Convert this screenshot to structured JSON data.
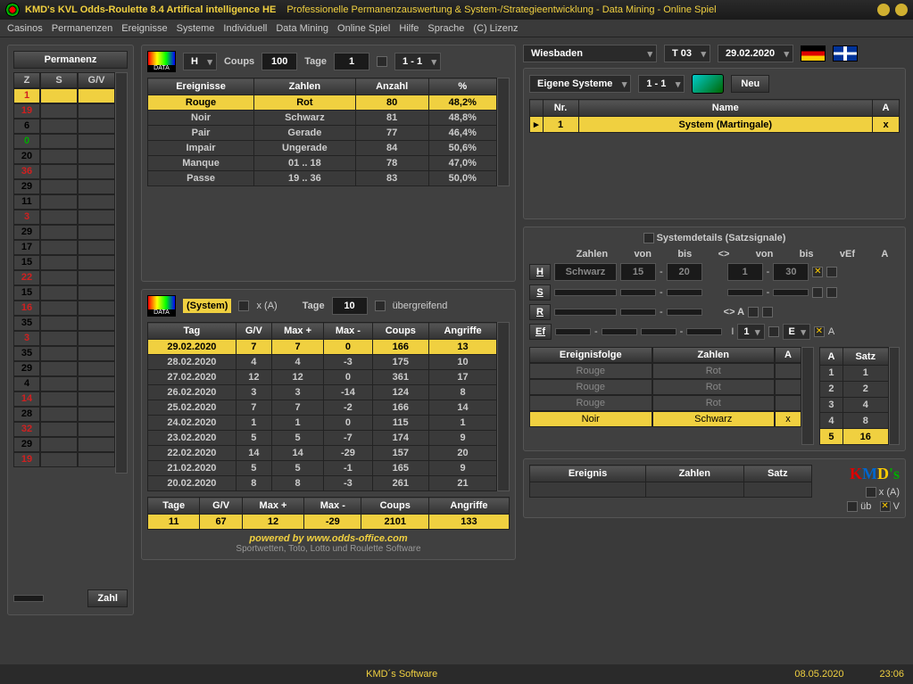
{
  "title1": "KMD's KVL Odds-Roulette 8.4 Artifical intelligence HE",
  "title2": "Professionelle Permanenzauswertung & System-/Strategieentwicklung - Data Mining - Online Spiel",
  "menu": [
    "Casinos",
    "Permanenzen",
    "Ereignisse",
    "Systeme",
    "Individuell",
    "Data Mining",
    "Online Spiel",
    "Hilfe",
    "Sprache",
    "(C) Lizenz"
  ],
  "permanenz": {
    "title": "Permanenz",
    "headers": [
      "Z",
      "S",
      "G/V"
    ],
    "rows": [
      {
        "z": "1",
        "c": "red",
        "hl": true
      },
      {
        "z": "19",
        "c": "red"
      },
      {
        "z": "6",
        "c": "black"
      },
      {
        "z": "0",
        "c": "green"
      },
      {
        "z": "20",
        "c": "black"
      },
      {
        "z": "36",
        "c": "red"
      },
      {
        "z": "29",
        "c": "black"
      },
      {
        "z": "11",
        "c": "black"
      },
      {
        "z": "3",
        "c": "red"
      },
      {
        "z": "29",
        "c": "black"
      },
      {
        "z": "17",
        "c": "black"
      },
      {
        "z": "15",
        "c": "black"
      },
      {
        "z": "22",
        "c": "red"
      },
      {
        "z": "15",
        "c": "black"
      },
      {
        "z": "16",
        "c": "red"
      },
      {
        "z": "35",
        "c": "black"
      },
      {
        "z": "3",
        "c": "red"
      },
      {
        "z": "35",
        "c": "black"
      },
      {
        "z": "29",
        "c": "black"
      },
      {
        "z": "4",
        "c": "black"
      },
      {
        "z": "14",
        "c": "red"
      },
      {
        "z": "28",
        "c": "black"
      },
      {
        "z": "32",
        "c": "red"
      },
      {
        "z": "29",
        "c": "black"
      },
      {
        "z": "19",
        "c": "red"
      }
    ],
    "zahl_btn": "Zahl"
  },
  "top2": {
    "h": "H",
    "coups_lbl": "Coups",
    "coups": "100",
    "tage_lbl": "Tage",
    "tage": "1",
    "range": "1 - 1"
  },
  "ereignisse": {
    "headers": [
      "Ereignisse",
      "Zahlen",
      "Anzahl",
      "%"
    ],
    "rows": [
      {
        "e": "Rouge",
        "z": "Rot",
        "a": "80",
        "p": "48,2%",
        "hl": true
      },
      {
        "e": "Noir",
        "z": "Schwarz",
        "a": "81",
        "p": "48,8%"
      },
      {
        "e": "Pair",
        "z": "Gerade",
        "a": "77",
        "p": "46,4%"
      },
      {
        "e": "Impair",
        "z": "Ungerade",
        "a": "84",
        "p": "50,6%"
      },
      {
        "e": "Manque",
        "z": "01 .. 18",
        "a": "78",
        "p": "47,0%"
      },
      {
        "e": "Passe",
        "z": "19 .. 36",
        "a": "83",
        "p": "50,0%"
      }
    ]
  },
  "system_panel": {
    "label": "(System)",
    "xa": "x (A)",
    "tage_lbl": "Tage",
    "tage": "10",
    "uber": "übergreifend",
    "headers": [
      "Tag",
      "G/V",
      "Max +",
      "Max -",
      "Coups",
      "Angriffe"
    ],
    "rows": [
      {
        "d": "29.02.2020",
        "gv": "7",
        "mp": "7",
        "mm": "0",
        "c": "166",
        "a": "13",
        "hl": true
      },
      {
        "d": "28.02.2020",
        "gv": "4",
        "mp": "4",
        "mm": "-3",
        "c": "175",
        "a": "10"
      },
      {
        "d": "27.02.2020",
        "gv": "12",
        "mp": "12",
        "mm": "0",
        "c": "361",
        "a": "17"
      },
      {
        "d": "26.02.2020",
        "gv": "3",
        "mp": "3",
        "mm": "-14",
        "c": "124",
        "a": "8"
      },
      {
        "d": "25.02.2020",
        "gv": "7",
        "mp": "7",
        "mm": "-2",
        "c": "166",
        "a": "14"
      },
      {
        "d": "24.02.2020",
        "gv": "1",
        "mp": "1",
        "mm": "0",
        "c": "115",
        "a": "1"
      },
      {
        "d": "23.02.2020",
        "gv": "5",
        "mp": "5",
        "mm": "-7",
        "c": "174",
        "a": "9"
      },
      {
        "d": "22.02.2020",
        "gv": "14",
        "mp": "14",
        "mm": "-29",
        "c": "157",
        "a": "20"
      },
      {
        "d": "21.02.2020",
        "gv": "5",
        "mp": "5",
        "mm": "-1",
        "c": "165",
        "a": "9"
      },
      {
        "d": "20.02.2020",
        "gv": "8",
        "mp": "8",
        "mm": "-3",
        "c": "261",
        "a": "21"
      }
    ],
    "sum_headers": [
      "Tage",
      "G/V",
      "Max +",
      "Max -",
      "Coups",
      "Angriffe"
    ],
    "sum": {
      "d": "11",
      "gv": "67",
      "mp": "12",
      "mm": "-29",
      "c": "2101",
      "a": "133"
    }
  },
  "footer1": "powered by www.odds-office.com",
  "footer2": "Sportwetten, Toto, Lotto und Roulette Software",
  "top3": {
    "casino": "Wiesbaden",
    "table": "T 03",
    "date": "29.02.2020"
  },
  "syslist": {
    "sel": "Eigene Systeme",
    "range": "1 - 1",
    "neu": "Neu",
    "headers": [
      "Nr.",
      "Name",
      "A"
    ],
    "rows": [
      {
        "nr": "1",
        "name": "System (Martingale)",
        "a": "x",
        "hl": true
      }
    ]
  },
  "details": {
    "title": "Systemdetails   (Satzsignale)",
    "cols": [
      "Zahlen",
      "von",
      "bis",
      "<>",
      "von",
      "bis",
      "vEf",
      "A"
    ],
    "btns": [
      "H",
      "S",
      "R",
      "Ef"
    ],
    "row1_z": "Schwarz",
    "row1_v1": "15",
    "row1_b1": "20",
    "row1_v2": "1",
    "row1_b2": "30",
    "arrow_lbl": "<> A",
    "one": "1",
    "e": "E",
    "a": "A"
  },
  "folge": {
    "headers": [
      "Ereignisfolge",
      "Zahlen",
      "A"
    ],
    "rows": [
      {
        "e": "Rouge",
        "z": "Rot",
        "a": ""
      },
      {
        "e": "Rouge",
        "z": "Rot",
        "a": ""
      },
      {
        "e": "Rouge",
        "z": "Rot",
        "a": ""
      },
      {
        "e": "Noir",
        "z": "Schwarz",
        "a": "x",
        "hl": true
      }
    ],
    "satz_h": [
      "A",
      "Satz"
    ],
    "satz": [
      [
        "1",
        "1"
      ],
      [
        "2",
        "2"
      ],
      [
        "3",
        "4"
      ],
      [
        "4",
        "8"
      ],
      [
        "5",
        "16"
      ]
    ]
  },
  "bottom3": {
    "headers": [
      "Ereignis",
      "Zahlen",
      "Satz"
    ],
    "xa": "x (A)",
    "ub": "üb",
    "v": "V"
  },
  "status": {
    "mid": "KMD´s Software",
    "date": "08.05.2020",
    "time": "23:06"
  }
}
